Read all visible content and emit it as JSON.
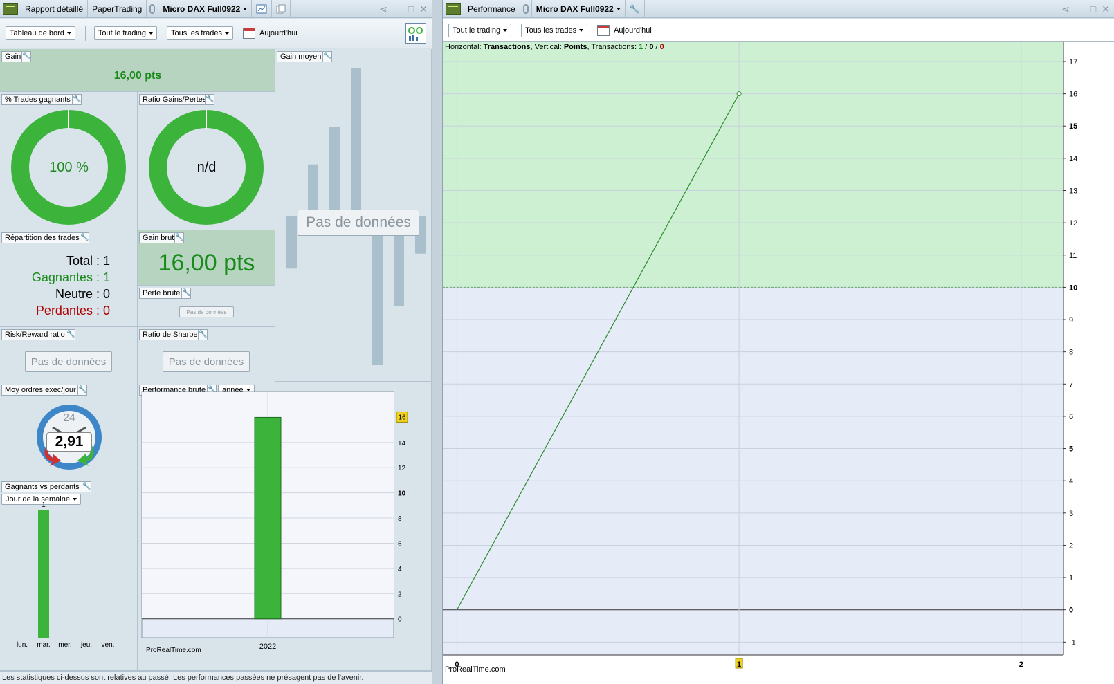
{
  "left_window": {
    "tabs": [
      "Rapport détaillé",
      "PaperTrading",
      "Micro DAX Full0922"
    ],
    "toolbar": {
      "dashboard": "Tableau de bord",
      "trading": "Tout le trading",
      "trades": "Tous les trades",
      "date": "Aujourd'hui"
    }
  },
  "right_window": {
    "tabs": [
      "Performance",
      "Micro DAX Full0922"
    ],
    "toolbar": {
      "trading": "Tout le trading",
      "trades": "Tous les trades",
      "date": "Aujourd'hui"
    }
  },
  "panels": {
    "gain": {
      "title": "Gain",
      "value": "16,00 pts"
    },
    "gain_moyen": {
      "title": "Gain moyen",
      "nodata": "Pas de données",
      "bars": [
        -0.35,
        0.35,
        0.6,
        1.0,
        -1.0,
        -0.6,
        -0.25
      ]
    },
    "pct_trades": {
      "title": "% Trades gagnants",
      "value": "100 %"
    },
    "ratio_gp": {
      "title": "Ratio Gains/Pertes",
      "value": "n/d"
    },
    "repartition": {
      "title": "Répartition des trades",
      "total": "Total : 1",
      "gagnantes": "Gagnantes : 1",
      "neutre": "Neutre : 0",
      "perdantes": "Perdantes : 0"
    },
    "gain_brut": {
      "title": "Gain brut",
      "value": "16,00 pts"
    },
    "perte_brute": {
      "title": "Perte brute",
      "nodata": "Pas de données"
    },
    "risk_reward": {
      "title": "Risk/Reward ratio",
      "nodata": "Pas de données"
    },
    "sharpe": {
      "title": "Ratio de Sharpe",
      "nodata": "Pas de données"
    },
    "moy_ordres": {
      "title": "Moy ordres exec/jour",
      "clock": "24",
      "value": "2,91"
    },
    "perf_brute": {
      "title": "Performance brute",
      "period": "année",
      "watermark": "ProRealTime.com"
    },
    "gvp": {
      "title": "Gagnants vs perdants",
      "mode": "Jour de la semaine"
    }
  },
  "status_text": "Les statistiques ci-dessus sont relatives au passé. Les performances passées ne présagent pas de l'avenir.",
  "perf_info": {
    "h_label": "Horizontal:",
    "h_val": "Transactions",
    "v_label": "Vertical:",
    "v_val": "Points",
    "t_label": "Transactions:",
    "t_win": "1",
    "t_neu": "0",
    "t_los": "0"
  },
  "perf_watermark": "ProRealTime.com",
  "colors": {
    "green": "#3cb43c",
    "dark_green": "#1a8a1a",
    "red": "#b00000",
    "badge": "#f0d020"
  },
  "chart_data": [
    {
      "type": "bar",
      "categories": [
        "2022"
      ],
      "values": [
        16
      ],
      "ylim": [
        -1.5,
        18
      ],
      "yticks": [
        0,
        2,
        4,
        6,
        8,
        10,
        12,
        14
      ],
      "highlight": "16"
    },
    {
      "type": "bar",
      "categories": [
        "lun.",
        "mar.",
        "mer.",
        "jeu.",
        "ven."
      ],
      "values": [
        0,
        1,
        0,
        0,
        0
      ],
      "labels": [
        "",
        "1",
        "",
        "",
        ""
      ]
    },
    {
      "type": "line",
      "x": [
        0,
        1
      ],
      "y": [
        0,
        16
      ],
      "xlim": [
        -0.05,
        2.15
      ],
      "ylim": [
        -1.4,
        17.6
      ],
      "yticks": [
        -1,
        0,
        1,
        2,
        3,
        4,
        5,
        6,
        7,
        8,
        9,
        10,
        11,
        12,
        13,
        14,
        15,
        16,
        17
      ],
      "xticks": [
        "0",
        "1",
        "2"
      ],
      "threshold": 10
    }
  ]
}
